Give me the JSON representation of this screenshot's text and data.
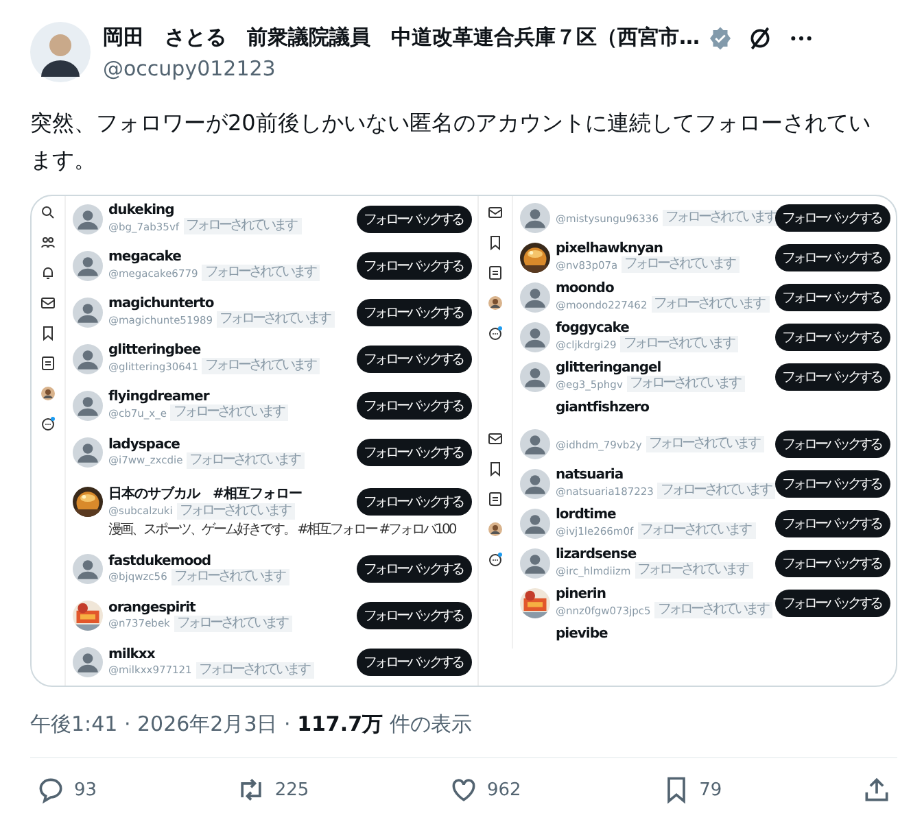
{
  "author": {
    "name": "岡田　さとる　前衆議院議員　中道改革連合兵庫７区（西宮市…",
    "handle": "@occupy012123"
  },
  "text": "突然、フォロワーが20前後しかいない匿名のアカウントに連続してフォローされています。",
  "screenshot": {
    "panels": [
      {
        "users": [
          {
            "name": "dukeking",
            "handle": "@bg_7ab35vf",
            "badge": "フォローされています",
            "button": "フォローバックする",
            "photo": false
          },
          {
            "name": "megacake",
            "handle": "@megacake6779",
            "badge": "フォローされています",
            "button": "フォローバックする",
            "photo": false
          },
          {
            "name": "magichunterto",
            "handle": "@magichunte51989",
            "badge": "フォローされています",
            "button": "フォローバックする",
            "photo": false
          },
          {
            "name": "glitteringbee",
            "handle": "@glittering30641",
            "badge": "フォローされています",
            "button": "フォローバックする",
            "photo": false
          },
          {
            "name": "flyingdreamer",
            "handle": "@cb7u_x_e",
            "badge": "フォローされています",
            "button": "フォローバックする",
            "photo": false
          },
          {
            "name": "ladyspace",
            "handle": "@i7ww_zxcdie",
            "badge": "フォローされています",
            "button": "フォローバックする",
            "photo": false
          },
          {
            "name": "日本のサブカル　#相互フォロー",
            "handle": "@subcalzuki",
            "badge": "フォローされています",
            "button": "フォローバックする",
            "photo": true,
            "bio": "漫画、スポーツ、ゲーム好きです。 #相互フォロー #フォロバ100"
          },
          {
            "name": "fastdukemood",
            "handle": "@bjqwzc56",
            "badge": "フォローされています",
            "button": "フォローバックする",
            "photo": false
          },
          {
            "name": "orangespirit",
            "handle": "@n737ebek",
            "badge": "フォローされています",
            "button": "フォローバックする",
            "photo": true
          },
          {
            "name": "milkxx",
            "handle": "@milkxx977121",
            "badge": "フォローされています",
            "button": "フォローバックする",
            "photo": false
          }
        ]
      },
      {
        "users": [
          {
            "handle": "@mistysungu96336",
            "badge": "フォローされています",
            "button": "フォローバックする",
            "photo": false
          },
          {
            "name": "pixelhawknyan",
            "handle": "@nv83p07a",
            "badge": "フォローされています",
            "button": "フォローバックする",
            "photo": true
          },
          {
            "name": "moondo",
            "handle": "@moondo227462",
            "badge": "フォローされています",
            "button": "フォローバックする",
            "photo": false
          },
          {
            "name": "foggycake",
            "handle": "@cljkdrgi29",
            "badge": "フォローされています",
            "button": "フォローバックする",
            "photo": false
          },
          {
            "name": "glitteringangel",
            "handle": "@eg3_5phgv",
            "badge": "フォローされています",
            "button": "フォローバックする",
            "photo": false
          },
          {
            "name": "giantfishzero"
          }
        ]
      },
      {
        "users": [
          {
            "handle": "@idhdm_79vb2y",
            "badge": "フォローされています",
            "button": "フォローバックする",
            "photo": false
          },
          {
            "name": "natsuaria",
            "handle": "@natsuaria187223",
            "badge": "フォローされています",
            "button": "フォローバックする",
            "photo": false
          },
          {
            "name": "lordtime",
            "handle": "@ivj1le266m0f",
            "badge": "フォローされています",
            "button": "フォローバックする",
            "photo": false
          },
          {
            "name": "lizardsense",
            "handle": "@irc_hlmdiizm",
            "badge": "フォローされています",
            "button": "フォローバックする",
            "photo": false
          },
          {
            "name": "pinerin",
            "handle": "@nnz0fgw073jpc5",
            "badge": "フォローされています",
            "button": "フォローバックする",
            "photo": true
          },
          {
            "name": "pievibe"
          }
        ]
      }
    ]
  },
  "meta": "午後1:41 · 2026年2月3日 · **117.7万** 件の表示",
  "actions": [
    {
      "kind": "reply",
      "count": "93"
    },
    {
      "kind": "repost",
      "count": "225"
    },
    {
      "kind": "like",
      "count": "962"
    },
    {
      "kind": "bookmark",
      "count": "79"
    },
    {
      "kind": "share"
    }
  ]
}
